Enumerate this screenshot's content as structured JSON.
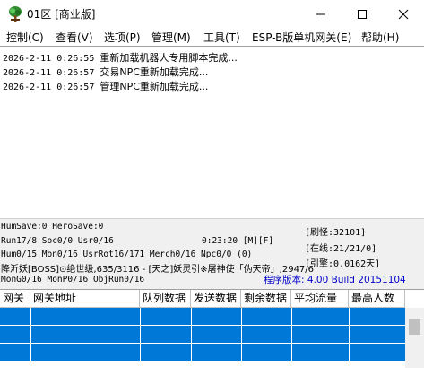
{
  "window": {
    "title": "01区 [商业版]",
    "icon": "tree-icon",
    "controls": [
      "minimize",
      "maximize",
      "close"
    ]
  },
  "menu": {
    "items": [
      {
        "label": "控制(C)"
      },
      {
        "label": "查看(V)"
      },
      {
        "label": "选项(P)"
      },
      {
        "label": "管理(M)"
      },
      {
        "label": "工具(T)"
      },
      {
        "label": "ESP-B版单机网关(E)"
      },
      {
        "label": "帮助(H)"
      }
    ]
  },
  "log": {
    "lines": [
      {
        "time": "2026-2-11 0:26:55",
        "message": "重新加载机器人专用脚本完成..."
      },
      {
        "time": "2026-2-11 0:26:57",
        "message": "交易NPC重新加载完成..."
      },
      {
        "time": "2026-2-11 0:26:57",
        "message": "管理NPC重新加载完成..."
      }
    ]
  },
  "status": {
    "line1": "HumSave:0 HeroSave:0",
    "line2": "Run17/8 Soc0/0 Usr0/16",
    "clock": "0:23:20 [M][F]",
    "line3": "Hum0/15 Mon0/16 UsrRot16/171 Merch0/16 Npc0/0 (0)",
    "line4": "降沂妖[BOSS]⊙绝世级,635/3116 - [天之]妖灵引※屠神使「伪天帝」,2947/6",
    "line5": "MonG0/16 MonP0/16 ObjRun0/16",
    "refresh": "[刷怪:32101]",
    "online": "[在线:21/21/0]",
    "engine": "[引擎:0.0162天]",
    "version": "程序版本: 4.00 Build 20151104"
  },
  "table": {
    "columns": [
      "网关",
      "网关地址",
      "队列数据",
      "发送数据",
      "剩余数据",
      "平均流量",
      "最高人数"
    ],
    "rows": [
      [
        "",
        "",
        "",
        "",
        "",
        "",
        ""
      ],
      [
        "",
        "",
        "",
        "",
        "",
        "",
        ""
      ],
      [
        "",
        "",
        "",
        "",
        "",
        "",
        ""
      ]
    ],
    "selected_color": "#0078d7"
  }
}
